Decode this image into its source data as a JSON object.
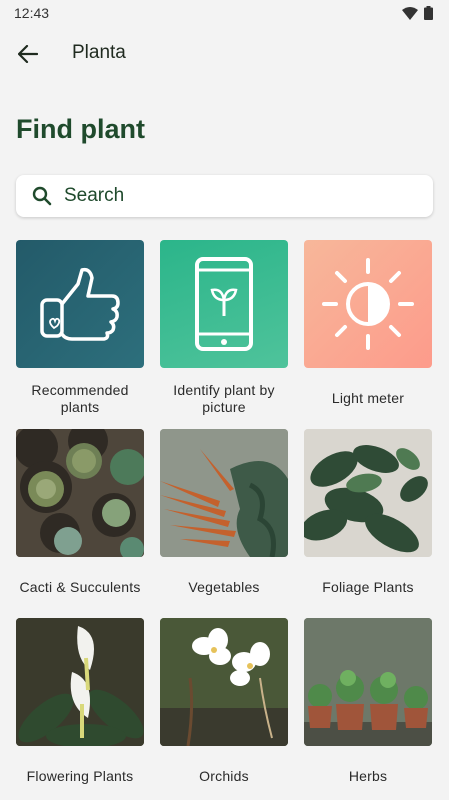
{
  "status_bar": {
    "time": "12:43",
    "icons": [
      "wifi-icon",
      "battery-icon"
    ]
  },
  "app_bar": {
    "title": "Planta",
    "back_icon": "arrow-back-icon"
  },
  "page": {
    "title": "Find plant"
  },
  "search": {
    "placeholder": "Search",
    "value": ""
  },
  "categories": [
    {
      "label": "Recommended plants"
    },
    {
      "label": "Identify plant by picture"
    },
    {
      "label": "Light meter"
    },
    {
      "label": "Cacti & Succulents"
    },
    {
      "label": "Vegetables"
    },
    {
      "label": "Foliage Plants"
    },
    {
      "label": "Flowering Plants"
    },
    {
      "label": "Orchids"
    },
    {
      "label": "Herbs"
    }
  ],
  "colors": {
    "background": "#f3f3f3",
    "title_green": "#1f4a2c",
    "recommended_tile": "#235a69",
    "identify_tile": "#2bb58a",
    "light_meter_tile": "#fd9b8b"
  }
}
